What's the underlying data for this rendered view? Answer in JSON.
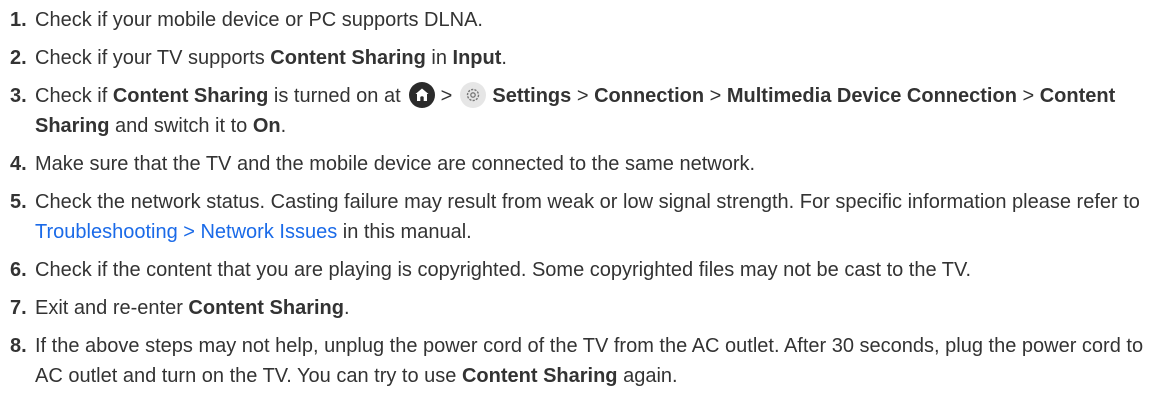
{
  "steps": [
    {
      "num": "1.",
      "t1": "Check if your mobile device or PC supports DLNA."
    },
    {
      "num": "2.",
      "t1": "Check if your TV supports ",
      "b1": "Content Sharing",
      "t2": " in ",
      "b2": "Input",
      "t3": "."
    },
    {
      "num": "3.",
      "t1": "Check if ",
      "b1": "Content Sharing",
      "t2": " is turned on at",
      "sep1": ">",
      "b2": "Settings",
      "sep2": " > ",
      "b3": "Connection",
      "sep3": " > ",
      "b4": "Multimedia Device Connection",
      "sep4": " > ",
      "b5": "Content Sharing",
      "t3": " and switch it to ",
      "b6": "On",
      "t4": "."
    },
    {
      "num": "4.",
      "t1": "Make sure that the TV and the mobile device are connected to the same network."
    },
    {
      "num": "5.",
      "t1": "Check the network status. Casting failure may result from weak or low signal strength. For specific information please refer to ",
      "link": "Troubleshooting > Network Issues",
      "t2": " in this manual."
    },
    {
      "num": "6.",
      "t1": "Check if the content that you are playing is copyrighted. Some copyrighted files may not be cast to the TV."
    },
    {
      "num": "7.",
      "t1": "Exit and re-enter ",
      "b1": "Content Sharing",
      "t2": "."
    },
    {
      "num": "8.",
      "t1": "If the above steps may not help, unplug the power cord of the TV from the AC outlet. After 30 seconds, plug the power cord to AC outlet and turn on the TV. You can try to use ",
      "b1": "Content Sharing",
      "t2": " again."
    }
  ],
  "icons": {
    "home": "home-icon",
    "settings": "settings-icon"
  }
}
